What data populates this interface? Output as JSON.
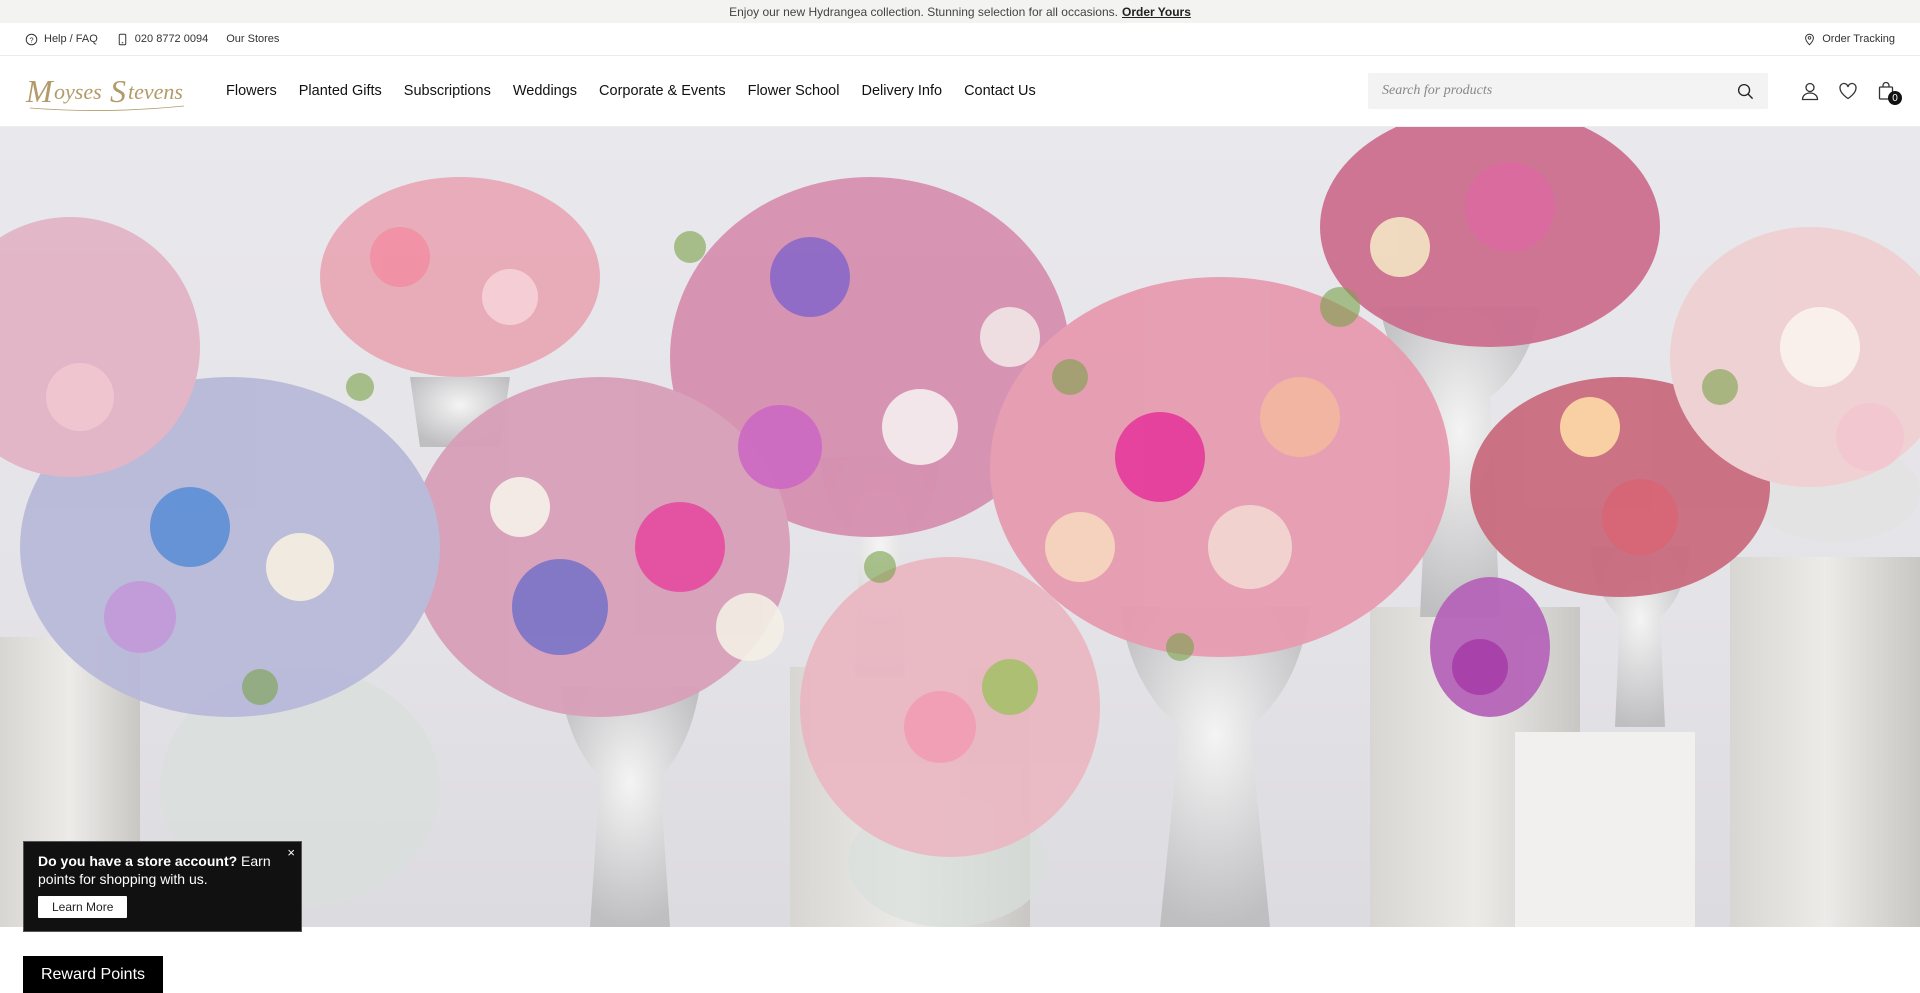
{
  "announcement": {
    "text": "Enjoy our new Hydrangea collection. Stunning selection for all occasions.",
    "link": "Order Yours"
  },
  "utility": {
    "help": "Help / FAQ",
    "phone": "020 8772 0094",
    "stores": "Our Stores",
    "tracking": "Order Tracking"
  },
  "brand": {
    "logo_text": "Moyses Stevens",
    "logo_color": "#b39a6a"
  },
  "nav": {
    "items": [
      "Flowers",
      "Planted Gifts",
      "Subscriptions",
      "Weddings",
      "Corporate & Events",
      "Flower School",
      "Delivery Info",
      "Contact Us"
    ]
  },
  "search": {
    "placeholder": "Search for products"
  },
  "header_icons": {
    "account": "user-icon",
    "wishlist": "heart-icon",
    "cart": "bag-icon",
    "cart_count": "0"
  },
  "popup": {
    "bold": "Do you have a store account?",
    "text": " Earn points for shopping with us.",
    "button": "Learn More",
    "close": "×"
  },
  "reward": {
    "label": "Reward Points"
  }
}
